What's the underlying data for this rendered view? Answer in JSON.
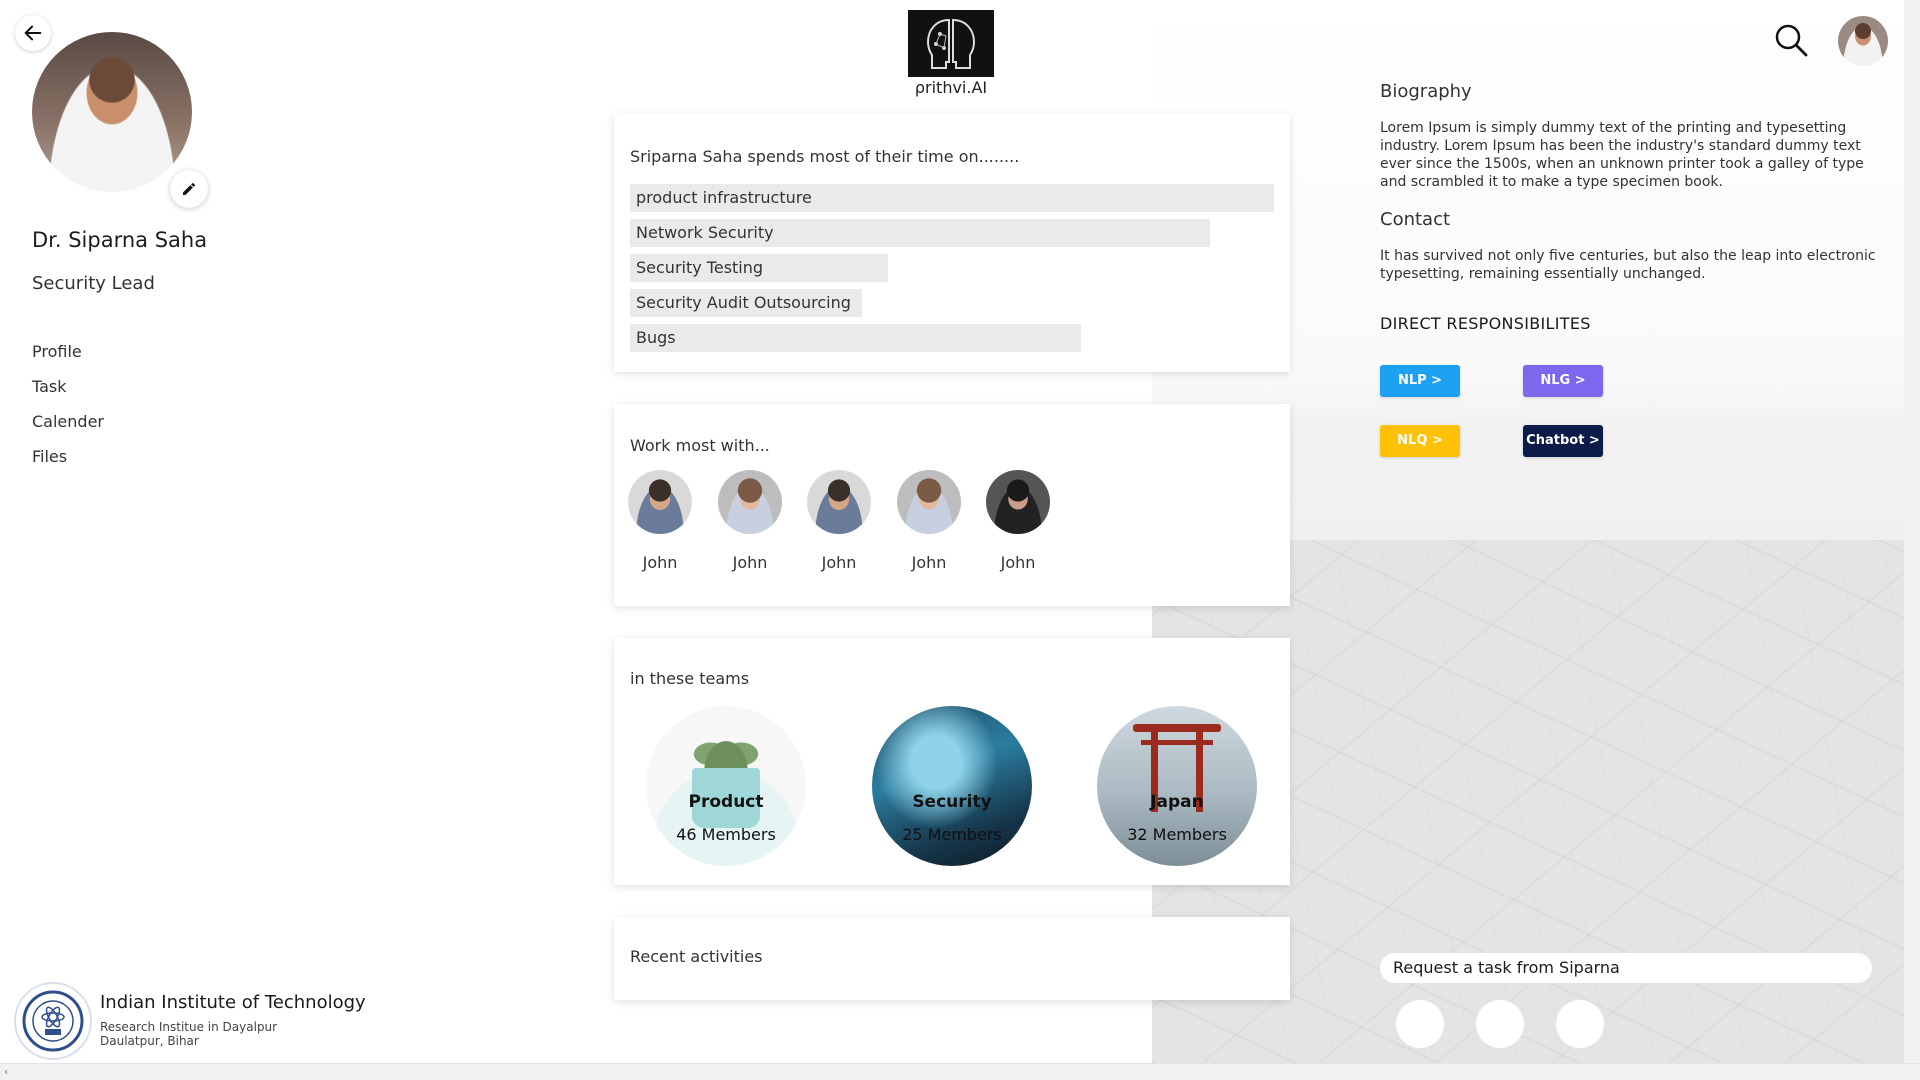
{
  "brand": {
    "name": "ρrithvi.AI"
  },
  "profile": {
    "name": "Dr. Siparna Saha",
    "role": "Security Lead"
  },
  "nav": {
    "items": [
      "Profile",
      "Task",
      "Calender",
      "Files"
    ]
  },
  "institute": {
    "name": "Indian Institute of Technology",
    "line1": "Research Institue in Dayalpur",
    "line2": "Daulatpur, Bihar"
  },
  "time_card": {
    "title": "Sriparna Saha spends most of their time on........",
    "items": [
      {
        "label": "product infrastructure",
        "share": 1.0
      },
      {
        "label": "Network Security",
        "share": 0.9
      },
      {
        "label": "Security Testing",
        "share": 0.4
      },
      {
        "label": "Security Audit Outsourcing",
        "share": 0.36
      },
      {
        "label": "Bugs",
        "share": 0.7
      }
    ]
  },
  "people_card": {
    "title": "Work most with...",
    "people": [
      "John",
      "John",
      "John",
      "John",
      "John"
    ]
  },
  "teams_card": {
    "title": "in these teams",
    "teams": [
      {
        "name": "Product",
        "members": "46 Members"
      },
      {
        "name": "Security",
        "members": "25 Members"
      },
      {
        "name": "Japan",
        "members": "32 Members"
      }
    ]
  },
  "recent_card": {
    "title": "Recent activities"
  },
  "right_panel": {
    "biography_heading": "Biography",
    "biography_text": "Lorem Ipsum is simply dummy text of the printing and typesetting industry. Lorem Ipsum has been the industry's standard dummy text ever since the 1500s, when an unknown printer took a galley of type and scrambled it to make a type specimen book.",
    "contact_heading": "Contact",
    "contact_text": "It has survived not only five centuries, but also the leap into electronic typesetting, remaining essentially unchanged.",
    "responsibilities_heading": "DIRECT RESPONSIBILITES",
    "buttons": {
      "nlp": "NLP >",
      "nlg": "NLG >",
      "nlq": "NLQ >",
      "chatbot": "Chatbot >"
    },
    "button_colors": {
      "nlp": "#1da1f2",
      "nlg": "#7b68ee",
      "nlq": "#ffc107",
      "chatbot": "#0b1c4a"
    },
    "request_task": "Request a task from Siparna"
  },
  "icons": [
    "back-arrow-icon",
    "edit-pencil-icon",
    "search-icon",
    "institute-logo-icon",
    "brand-logo-icon"
  ]
}
